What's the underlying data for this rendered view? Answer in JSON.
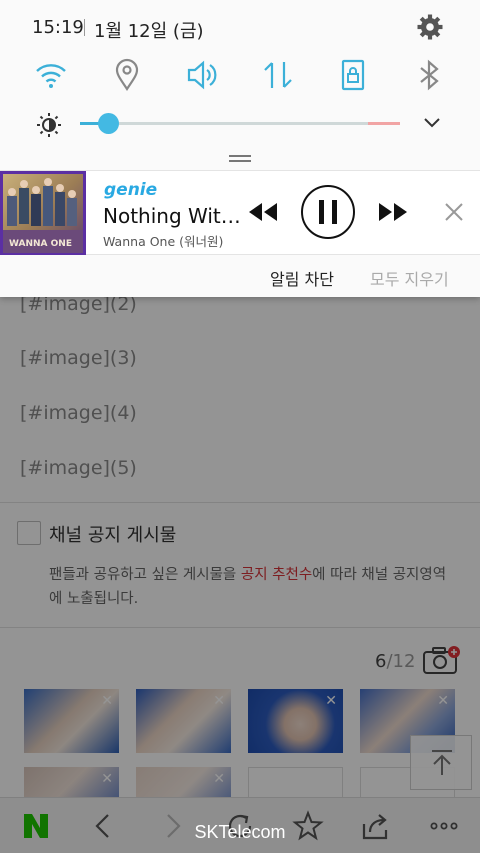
{
  "status": {
    "time": "15:19",
    "date": "1월 12일 (금)"
  },
  "quick_settings": [
    "wifi-icon",
    "location-icon",
    "sound-icon",
    "mobile-data-icon",
    "screen-lock-icon",
    "bluetooth-icon"
  ],
  "brightness": {
    "level": 0.09
  },
  "media": {
    "app": "genie",
    "title": "Nothing Wit…",
    "artist": "Wanna One (워너원)",
    "album_art_text": "WANNA ONE"
  },
  "notification_actions": {
    "block": "알림 차단",
    "clear_all": "모두 지우기"
  },
  "content": {
    "image_placeholders": [
      "[#image](2)",
      "[#image](3)",
      "[#image](4)",
      "[#image](5)"
    ],
    "notice": {
      "title": "채널 공지 게시물",
      "desc_before": "팬들과 공유하고 싶은 게시물을 ",
      "desc_highlight": "공지 추천수",
      "desc_after": "에 따라 채널 공지영역에 노출됩니다."
    },
    "image_count": "6",
    "image_total": "/12"
  },
  "colors": {
    "accent": "#3cb0d8",
    "highlight": "#d8343a",
    "naver_green": "#1ec800"
  },
  "bottom_bar": {
    "carrier": "SKTelecom"
  }
}
